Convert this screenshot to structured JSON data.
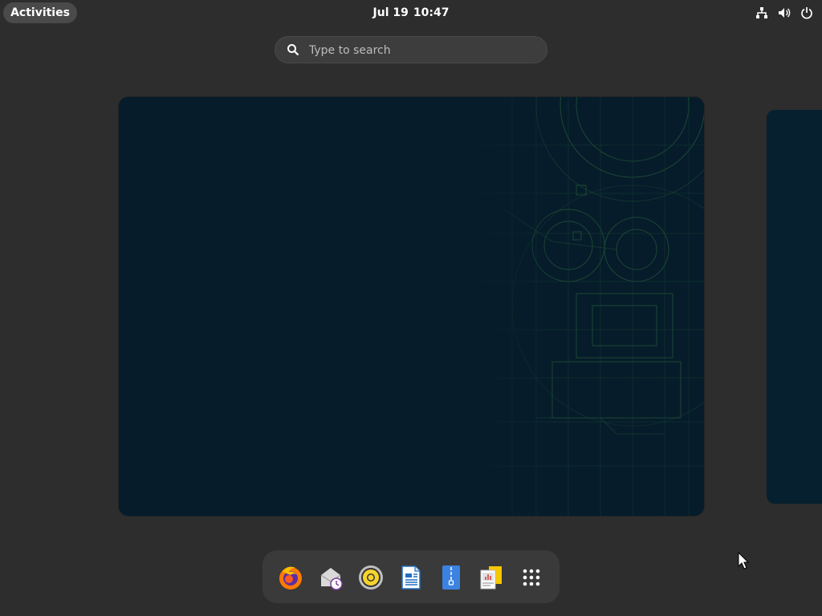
{
  "topbar": {
    "activities_label": "Activities",
    "clock_date": "Jul 19",
    "clock_time": "10:47",
    "tray_icons": [
      "network-icon",
      "volume-icon",
      "power-icon"
    ]
  },
  "search": {
    "placeholder": "Type to search",
    "icon": "search-icon"
  },
  "dash": {
    "apps": [
      {
        "name": "firefox",
        "icon": "firefox-icon"
      },
      {
        "name": "evolution",
        "icon": "evolution-mail-icon"
      },
      {
        "name": "rhythmbox",
        "icon": "rhythmbox-icon"
      },
      {
        "name": "libreoffice-writer",
        "icon": "writer-document-icon"
      },
      {
        "name": "file-roller",
        "icon": "archive-manager-icon"
      },
      {
        "name": "libreoffice-impress",
        "icon": "impress-icon"
      },
      {
        "name": "show-applications",
        "icon": "app-grid-icon"
      }
    ]
  },
  "colors": {
    "background": "#2d2d2d",
    "workspace": "#061c2a",
    "dash": "#3a3a3a",
    "accent_green": "#2f6b3f"
  }
}
